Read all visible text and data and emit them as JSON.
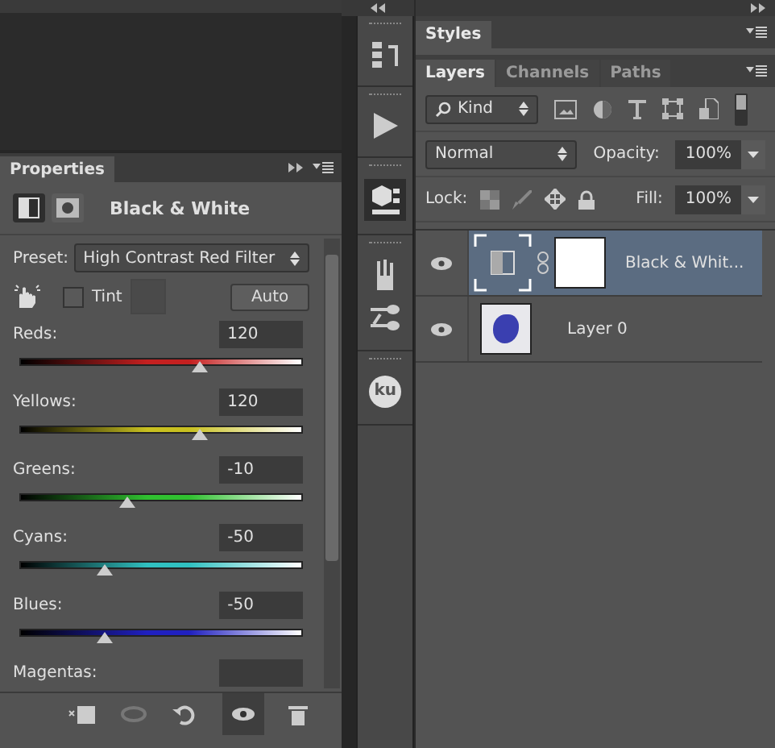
{
  "properties_panel": {
    "title": "Properties",
    "adjustment_title": "Black & White",
    "mode_buttons": [
      {
        "kind": "adjustment",
        "selected": true
      },
      {
        "kind": "mask",
        "selected": false
      }
    ],
    "preset": {
      "label": "Preset:",
      "value": "High Contrast Red Filter"
    },
    "tint": {
      "label": "Tint",
      "checked": false
    },
    "auto_button": "Auto",
    "sliders": [
      {
        "label": "Reds:",
        "value": "120",
        "level": 0.64,
        "color": "#c42020"
      },
      {
        "label": "Yellows:",
        "value": "120",
        "level": 0.64,
        "color": "#c8c020"
      },
      {
        "label": "Greens:",
        "value": "-10",
        "level": 0.38,
        "color": "#30c030"
      },
      {
        "label": "Cyans:",
        "value": "-50",
        "level": 0.3,
        "color": "#30c0c0"
      },
      {
        "label": "Blues:",
        "value": "-50",
        "level": 0.3,
        "color": "#2020c0"
      },
      {
        "label": "Magentas:"
      }
    ]
  },
  "dock": {
    "badge": "ku"
  },
  "layers_panel": {
    "top_tabs": [
      {
        "label": "Styles",
        "selected": true
      }
    ],
    "tabs": [
      {
        "label": "Layers",
        "selected": true
      },
      {
        "label": "Channels",
        "selected": false
      },
      {
        "label": "Paths",
        "selected": false
      }
    ],
    "filter": {
      "value": "Kind"
    },
    "blend_mode": "Normal",
    "opacity": {
      "label": "Opacity:",
      "value": "100%"
    },
    "lock_label": "Lock:",
    "fill": {
      "label": "Fill:",
      "value": "100%"
    },
    "layers": [
      {
        "name": "Black & Whit...",
        "kind": "adjustment",
        "selected": true,
        "visible": true
      },
      {
        "name": "Layer 0",
        "kind": "image",
        "selected": false,
        "visible": true
      }
    ]
  }
}
